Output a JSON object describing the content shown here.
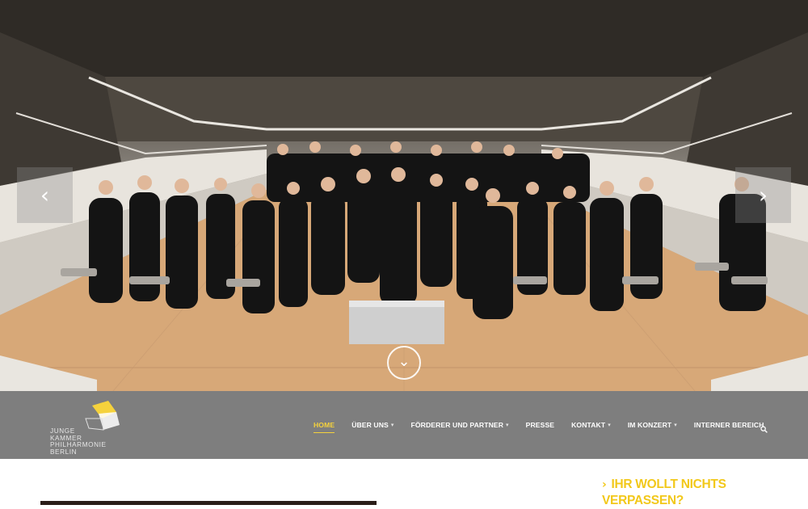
{
  "hero": {
    "prev_arrow": "‹",
    "next_arrow": "›",
    "scroll_down": "⌄"
  },
  "logo": {
    "lines": [
      "JUNGE",
      "KAMMER",
      "PHILHARMONIE",
      "BERLIN"
    ]
  },
  "nav": {
    "items": [
      {
        "label": "HOME",
        "dropdown": false,
        "active": true
      },
      {
        "label": "ÜBER UNS",
        "dropdown": true,
        "active": false
      },
      {
        "label": "FÖRDERER UND PARTNER",
        "dropdown": true,
        "active": false
      },
      {
        "label": "PRESSE",
        "dropdown": false,
        "active": false
      },
      {
        "label": "KONTAKT",
        "dropdown": true,
        "active": false
      },
      {
        "label": "IM KONZERT",
        "dropdown": true,
        "active": false
      },
      {
        "label": "INTERNER BEREICH",
        "dropdown": false,
        "active": false
      }
    ],
    "search_icon": "search-icon",
    "caret": "▾"
  },
  "sidebar": {
    "cta_line1": "IHR WOLLT NICHTS",
    "cta_line2": "VERPASSEN?",
    "chevron": "›"
  },
  "colors": {
    "accent": "#f5d23c",
    "nav_bg": "#7e7e7e",
    "cta": "#f2c81a"
  }
}
